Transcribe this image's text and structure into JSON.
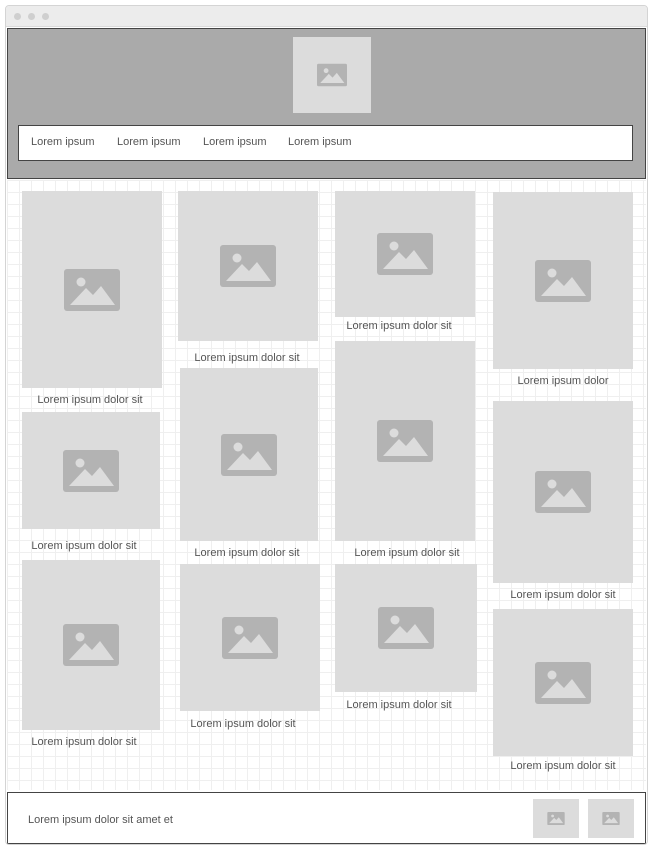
{
  "nav": {
    "items": [
      "Lorem ipsum",
      "Lorem ipsum",
      "Lorem ipsum",
      "Lorem ipsum"
    ]
  },
  "gallery": {
    "columns": [
      [
        "Lorem ipsum dolor sit",
        "Lorem ipsum dolor sit",
        "Lorem ipsum dolor sit"
      ],
      [
        "Lorem ipsum dolor sit",
        "Lorem ipsum dolor sit",
        "Lorem ipsum dolor sit"
      ],
      [
        "Lorem ipsum dolor sit",
        "Lorem ipsum dolor sit",
        "Lorem ipsum dolor sit"
      ],
      [
        "Lorem ipsum dolor",
        "Lorem ipsum dolor sit",
        "Lorem ipsum dolor sit"
      ]
    ]
  },
  "footer": {
    "text": "Lorem ipsum dolor sit amet et"
  },
  "colors": {
    "header_bg": "#aaaaaa",
    "placeholder_bg": "#dcdcdc",
    "placeholder_icon": "#b3b3b3"
  },
  "icons": {
    "placeholder": "image-icon"
  }
}
